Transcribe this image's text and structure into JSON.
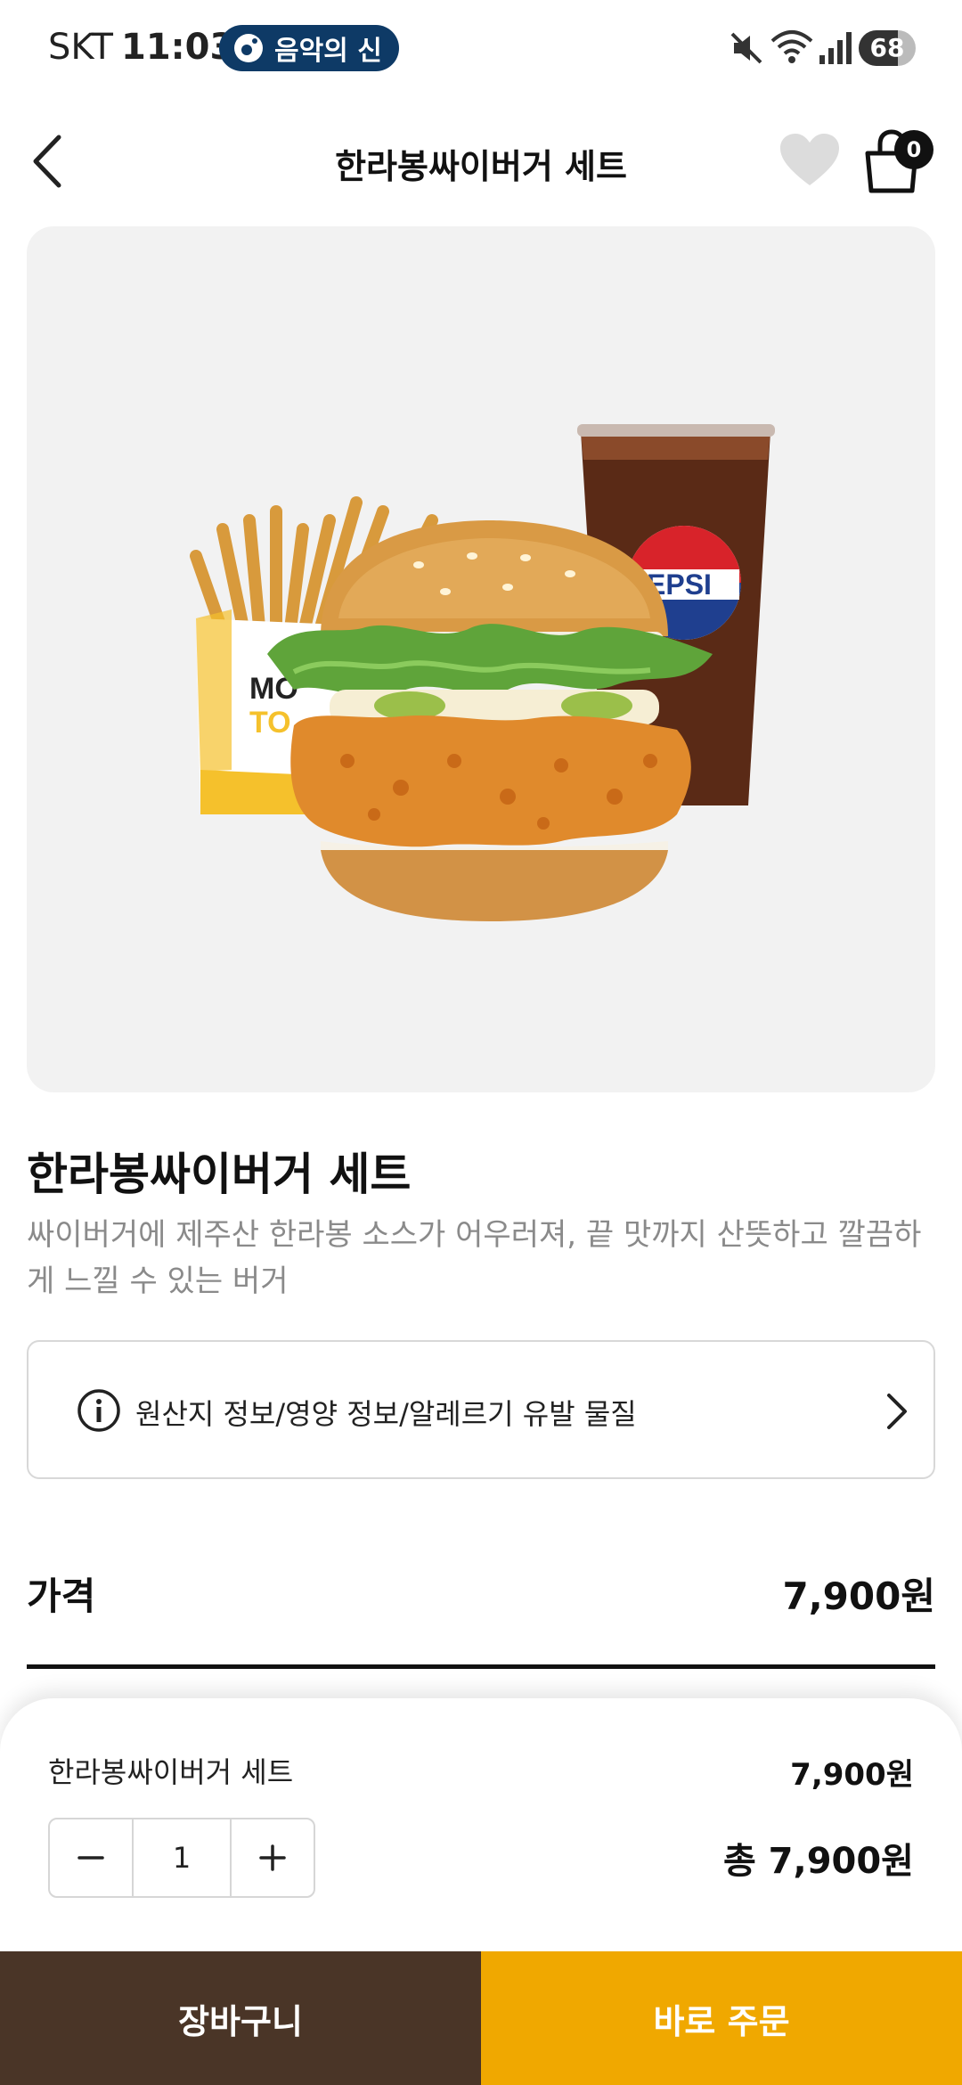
{
  "status_bar": {
    "carrier": "SKT",
    "time": "11:03",
    "badge_label": "음악의 신",
    "battery": "68",
    "battery_level": 0.68,
    "icons": [
      "mute-icon",
      "wifi-icon",
      "signal-icon",
      "battery-icon"
    ]
  },
  "header": {
    "title": "한라봉싸이버거 세트",
    "cart_count": "0"
  },
  "product": {
    "name": "한라봉싸이버거 세트",
    "description": "싸이버거에 제주산 한라봉 소스가 어우러져, 끝 맛까지 산뜻하고 깔끔하게 느낄 수 있는 버거",
    "info_link": "원산지 정보/영양 정보/알레르기 유발 물질",
    "price_label": "가격",
    "price": "7,900원",
    "image_text": {
      "bag_line1": "MO",
      "bag_line2": "TO",
      "cup_logo": "EPSI"
    }
  },
  "order_sheet": {
    "item_name": "한라봉싸이버거 세트",
    "item_price": "7,900원",
    "quantity": "1",
    "total": "총 7,900원"
  },
  "actions": {
    "cart_label": "장바구니",
    "order_label": "바로 주문"
  },
  "colors": {
    "accent": "#f0a800",
    "cart_button": "#4a3527",
    "badge": "#0e3a66",
    "image_bg": "#f2f2f2"
  }
}
